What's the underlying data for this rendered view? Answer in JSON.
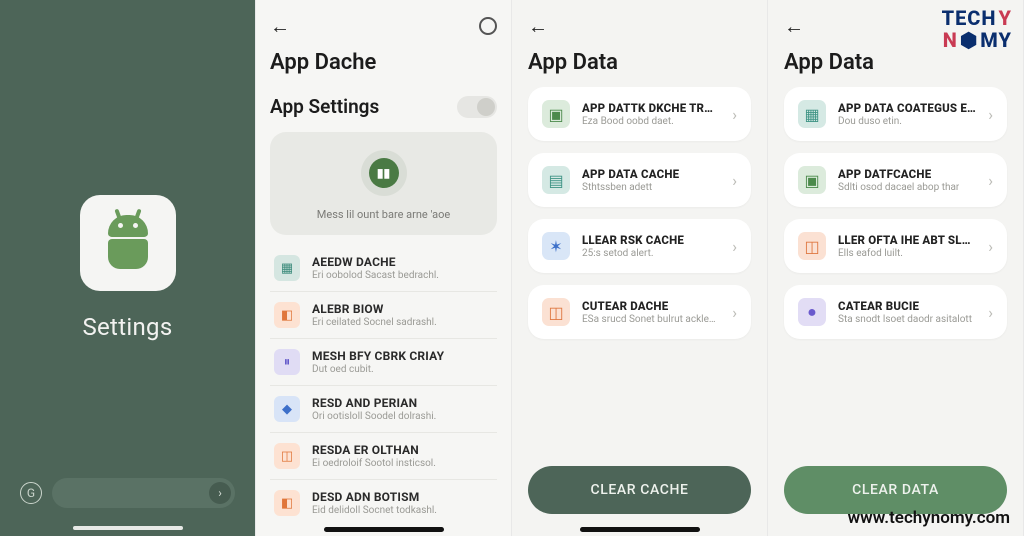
{
  "brand": {
    "name_line1_a": "TECH",
    "name_line1_b": "Y",
    "name_line2_a": "N",
    "name_line2_b": "O",
    "name_line2_c": "MY",
    "url": "www.techynomy.com"
  },
  "panel1": {
    "title": "Settings"
  },
  "panel2": {
    "title": "App Dache",
    "subtitle": "App Settings",
    "hero_sub": "Mess lil ount bare arne 'aoe",
    "items": [
      {
        "icon": "teal",
        "glyph": "▦",
        "title": "AEEDW DACHE",
        "sub": "Eri oobolod Sacast bedrachl."
      },
      {
        "icon": "orange",
        "glyph": "◧",
        "title": "ALEBR BIOW",
        "sub": "Eri ceilated Socnel sadrashl."
      },
      {
        "icon": "purple",
        "glyph": "⏸",
        "title": "MESH BFY CBRK CRIAY",
        "sub": "Dut oed cubit."
      },
      {
        "icon": "blue",
        "glyph": "◆",
        "title": "RESD AND PERIAN",
        "sub": "Ori ootisloll Soodel dolrashi."
      },
      {
        "icon": "orange",
        "glyph": "◫",
        "title": "RESDA ER OLTHAN",
        "sub": "Ei oedroloif Sootol insticsol."
      },
      {
        "icon": "orange",
        "glyph": "◧",
        "title": "DESD ADN BOTISM",
        "sub": "Eid delidoll Socnet todkashl."
      }
    ]
  },
  "panel3": {
    "title": "App Data",
    "cta": "CLEAR CACHE",
    "cards": [
      {
        "icon": "green",
        "glyph": "▣",
        "title": "APP DATTK DKCHE TROITHE",
        "sub": "Eza Bood oobd daet."
      },
      {
        "icon": "teal",
        "glyph": "▤",
        "title": "APP DATA CACHE",
        "sub": "Sthtssben adett"
      },
      {
        "icon": "blue",
        "glyph": "✶",
        "title": "LLEAR RSK CACHE",
        "sub": "25:s setod alert."
      },
      {
        "icon": "orange",
        "glyph": "◫",
        "title": "CUTEAR DACHE",
        "sub": "ESa srucd Sonet bulrut ackleht."
      }
    ]
  },
  "panel4": {
    "title": "App Data",
    "cta": "CLEAR DATA",
    "cards": [
      {
        "icon": "teal",
        "glyph": "▦",
        "title": "APP DATA COATEGUS EINE",
        "sub": "Dou duso etin."
      },
      {
        "icon": "green",
        "glyph": "▣",
        "title": "APP DATFCACHE",
        "sub": "Sdlti osod dacael abop thar"
      },
      {
        "icon": "orange",
        "glyph": "◫",
        "title": "LLER OFTA IHE ABT SLENTE",
        "sub": "Ells eafod luilt."
      },
      {
        "icon": "purple",
        "glyph": "●",
        "title": "CATEAR BUCIE",
        "sub": "Sta snodt lsoet daodr asitalott"
      }
    ]
  }
}
